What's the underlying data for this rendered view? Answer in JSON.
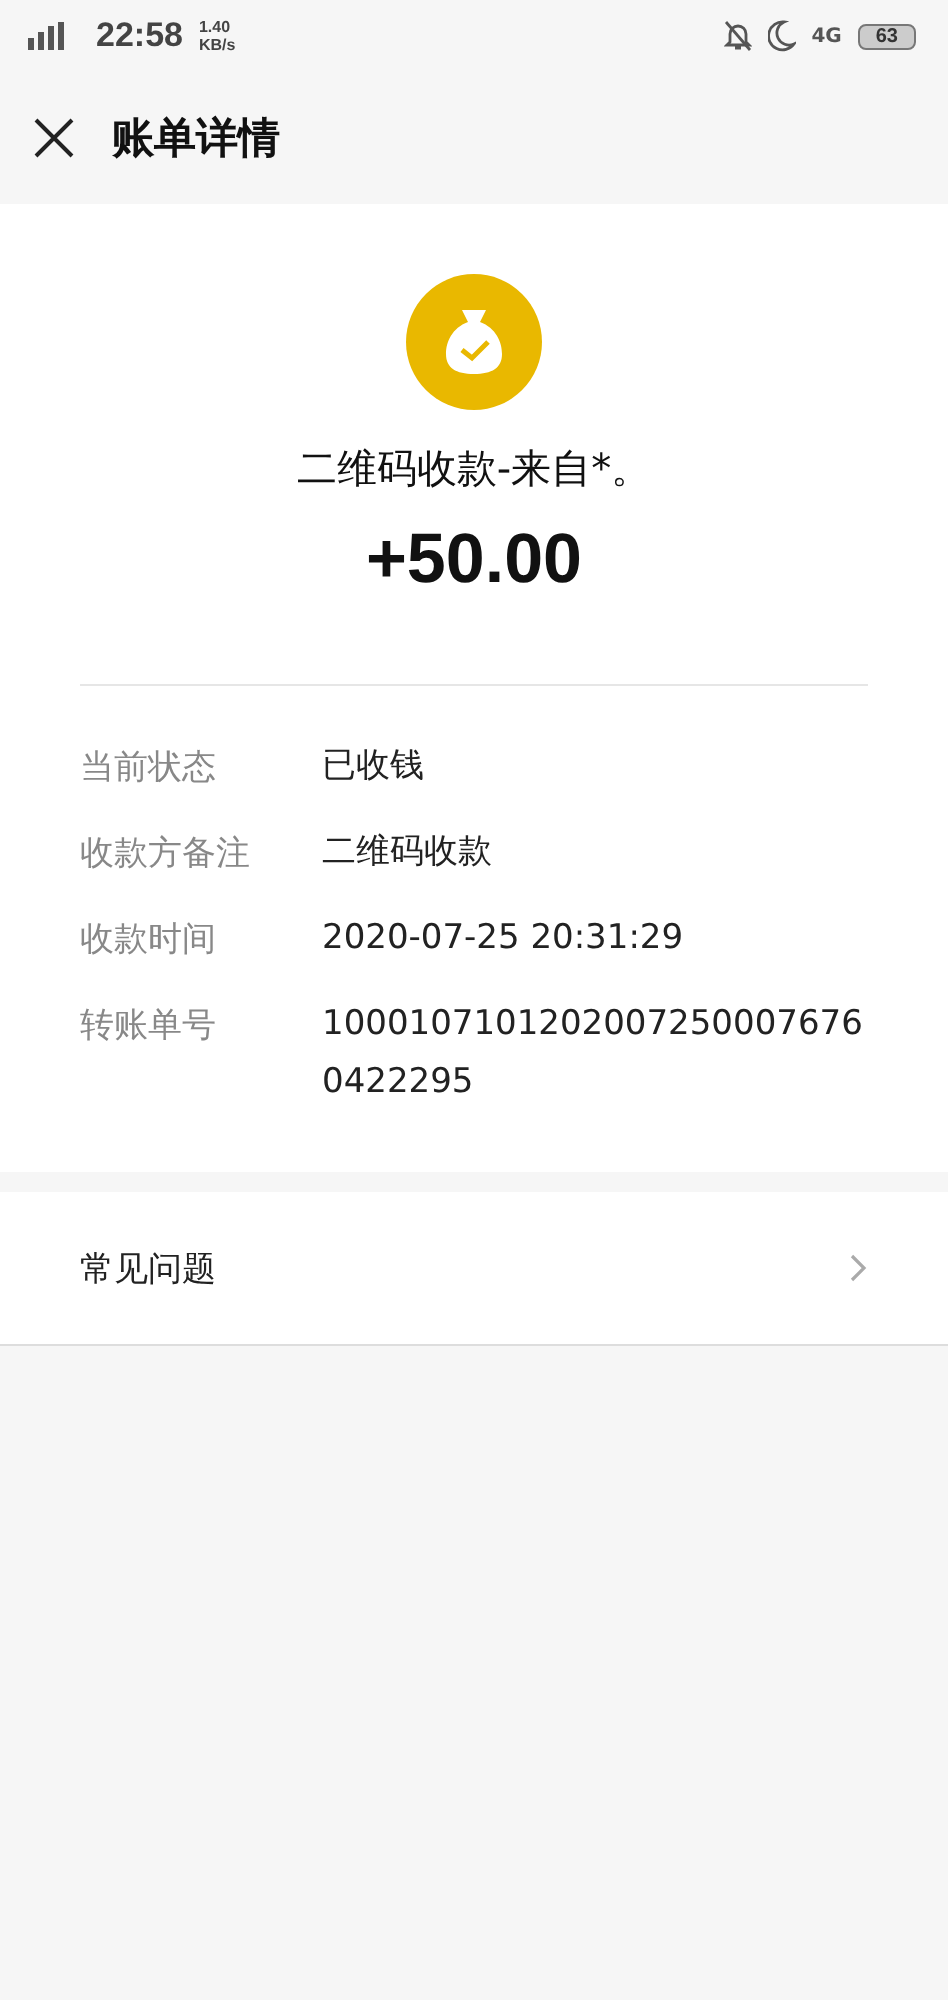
{
  "status_bar": {
    "time": "22:58",
    "speed_value": "1.40",
    "speed_unit": "KB/s",
    "network": "4G",
    "battery": "63"
  },
  "header": {
    "title": "账单详情"
  },
  "summary": {
    "title": "二维码收款-来自*。",
    "amount": "+50.00"
  },
  "details": [
    {
      "label": "当前状态",
      "value": "已收钱"
    },
    {
      "label": "收款方备注",
      "value": "二维码收款"
    },
    {
      "label": "收款时间",
      "value": "2020-07-25 20:31:29"
    },
    {
      "label": "转账单号",
      "value": "10001071012020072500076760422295"
    }
  ],
  "faq": {
    "label": "常见问题"
  }
}
